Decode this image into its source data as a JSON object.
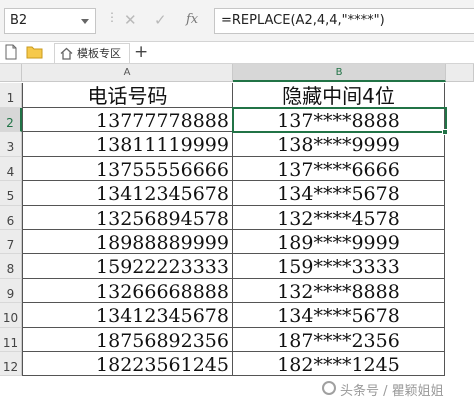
{
  "formula_bar": {
    "name_box": "B2",
    "separator": "⋮",
    "cancel_glyph": "✕",
    "enter_glyph": "✓",
    "fx_glyph": "fx",
    "formula": "=REPLACE(A2,4,4,\"****\")"
  },
  "tab_bar": {
    "tab_label": "模板专区",
    "add_glyph": "+"
  },
  "grid": {
    "columns": [
      "A",
      "B"
    ],
    "selected_column": "B",
    "selected_row": "2",
    "header": [
      "电话号码",
      "隐藏中间4位"
    ],
    "rows": [
      {
        "num": "1"
      },
      {
        "num": "2",
        "a": "13777778888",
        "b": "137****8888"
      },
      {
        "num": "3",
        "a": "13811119999",
        "b": "138****9999"
      },
      {
        "num": "4",
        "a": "13755556666",
        "b": "137****6666"
      },
      {
        "num": "5",
        "a": "13412345678",
        "b": "134****5678"
      },
      {
        "num": "6",
        "a": "13256894578",
        "b": "132****4578"
      },
      {
        "num": "7",
        "a": "18988889999",
        "b": "189****9999"
      },
      {
        "num": "8",
        "a": "15922223333",
        "b": "159****3333"
      },
      {
        "num": "9",
        "a": "13266668888",
        "b": "132****8888"
      },
      {
        "num": "10",
        "a": "13412345678",
        "b": "134****5678"
      },
      {
        "num": "11",
        "a": "18756892356",
        "b": "187****2356"
      },
      {
        "num": "12",
        "a": "18223561245",
        "b": "182****1245"
      }
    ]
  },
  "watermark": "头条号 / 瞿颖姐姐",
  "colors": {
    "accent": "#217346",
    "header_bg": "#ececec",
    "column_bar": "#a7d7bd"
  }
}
